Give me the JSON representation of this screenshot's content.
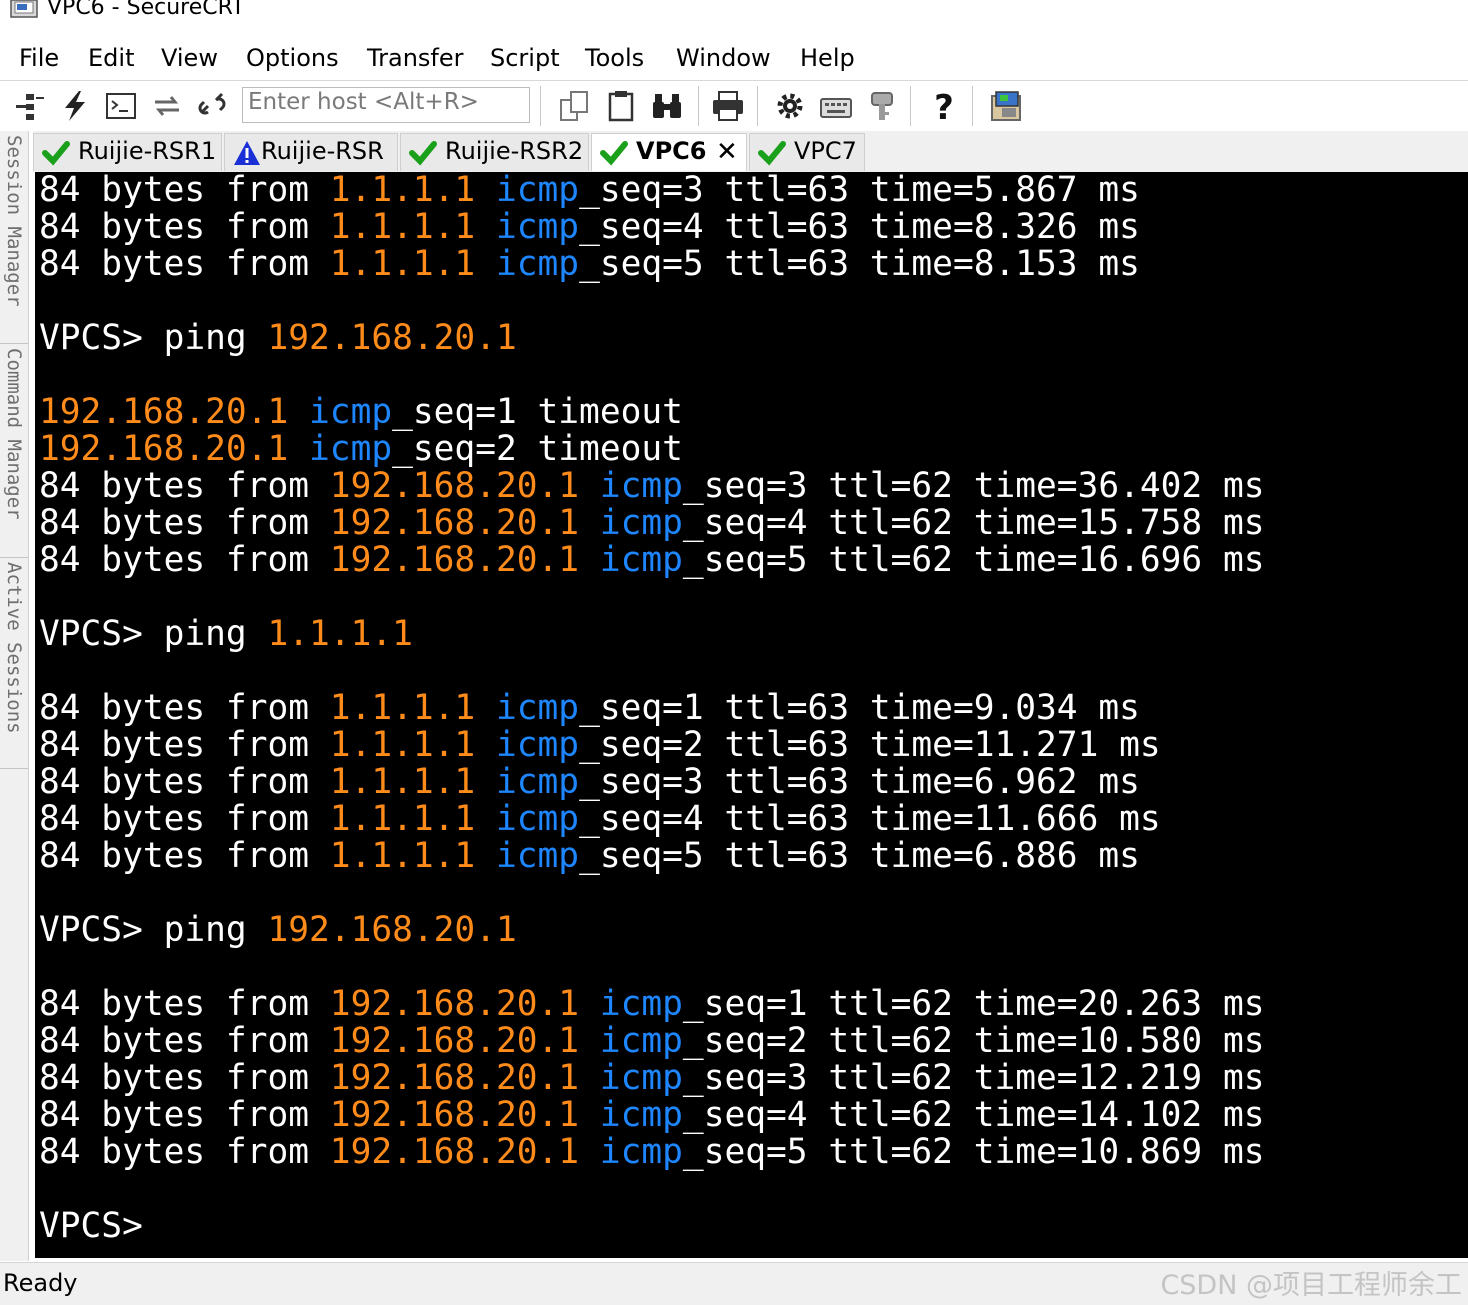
{
  "window": {
    "title": "VPC6 - SecureCRT"
  },
  "menu": [
    "File",
    "Edit",
    "View",
    "Options",
    "Transfer",
    "Script",
    "Tools",
    "Window",
    "Help"
  ],
  "toolbar": {
    "quick_connect_placeholder": "Enter host <Alt+R>",
    "icons": [
      "connect-icon",
      "quick-connect-icon",
      "connect-in-tab-icon",
      "reconnect-icon",
      "disconnect-icon",
      "copy-icon",
      "paste-icon",
      "find-icon",
      "print-icon",
      "settings-icon",
      "keymap-icon",
      "key-icon",
      "help-icon",
      "sftp-icon"
    ]
  },
  "side_panel": [
    "Session Manager",
    "Command Manager",
    "Active Sessions"
  ],
  "tabs": [
    {
      "label": "Ruijie-RSR1",
      "status": "connected",
      "active": false
    },
    {
      "label": "Ruijie-RSR",
      "status": "warning",
      "active": false
    },
    {
      "label": "Ruijie-RSR2",
      "status": "connected",
      "active": false
    },
    {
      "label": "VPC6",
      "status": "connected",
      "active": true,
      "close": "✕"
    },
    {
      "label": "VPC7",
      "status": "connected",
      "active": false
    }
  ],
  "colors": {
    "ip": "#ff8c1a",
    "icmp": "#1e86ff",
    "text": "#ffffff",
    "background": "#000000",
    "ok_check": "#1aa01a",
    "warning": "#1a2fd6"
  },
  "terminal": {
    "lines": [
      [
        [
          "84 bytes from ",
          "w"
        ],
        [
          "1.1.1.1",
          "o"
        ],
        [
          " ",
          "w"
        ],
        [
          "icmp",
          "b"
        ],
        [
          "_seq=3 ttl=63 time=5.867 ms",
          "w"
        ]
      ],
      [
        [
          "84 bytes from ",
          "w"
        ],
        [
          "1.1.1.1",
          "o"
        ],
        [
          " ",
          "w"
        ],
        [
          "icmp",
          "b"
        ],
        [
          "_seq=4 ttl=63 time=8.326 ms",
          "w"
        ]
      ],
      [
        [
          "84 bytes from ",
          "w"
        ],
        [
          "1.1.1.1",
          "o"
        ],
        [
          " ",
          "w"
        ],
        [
          "icmp",
          "b"
        ],
        [
          "_seq=5 ttl=63 time=8.153 ms",
          "w"
        ]
      ],
      [],
      [
        [
          "VPCS> ping ",
          "w"
        ],
        [
          "192.168.20.1",
          "o"
        ]
      ],
      [],
      [
        [
          "192.168.20.1",
          "o"
        ],
        [
          " ",
          "w"
        ],
        [
          "icmp",
          "b"
        ],
        [
          "_seq=1 timeout",
          "w"
        ]
      ],
      [
        [
          "192.168.20.1",
          "o"
        ],
        [
          " ",
          "w"
        ],
        [
          "icmp",
          "b"
        ],
        [
          "_seq=2 timeout",
          "w"
        ]
      ],
      [
        [
          "84 bytes from ",
          "w"
        ],
        [
          "192.168.20.1",
          "o"
        ],
        [
          " ",
          "w"
        ],
        [
          "icmp",
          "b"
        ],
        [
          "_seq=3 ttl=62 time=36.402 ms",
          "w"
        ]
      ],
      [
        [
          "84 bytes from ",
          "w"
        ],
        [
          "192.168.20.1",
          "o"
        ],
        [
          " ",
          "w"
        ],
        [
          "icmp",
          "b"
        ],
        [
          "_seq=4 ttl=62 time=15.758 ms",
          "w"
        ]
      ],
      [
        [
          "84 bytes from ",
          "w"
        ],
        [
          "192.168.20.1",
          "o"
        ],
        [
          " ",
          "w"
        ],
        [
          "icmp",
          "b"
        ],
        [
          "_seq=5 ttl=62 time=16.696 ms",
          "w"
        ]
      ],
      [],
      [
        [
          "VPCS> ping ",
          "w"
        ],
        [
          "1.1.1.1",
          "o"
        ]
      ],
      [],
      [
        [
          "84 bytes from ",
          "w"
        ],
        [
          "1.1.1.1",
          "o"
        ],
        [
          " ",
          "w"
        ],
        [
          "icmp",
          "b"
        ],
        [
          "_seq=1 ttl=63 time=9.034 ms",
          "w"
        ]
      ],
      [
        [
          "84 bytes from ",
          "w"
        ],
        [
          "1.1.1.1",
          "o"
        ],
        [
          " ",
          "w"
        ],
        [
          "icmp",
          "b"
        ],
        [
          "_seq=2 ttl=63 time=11.271 ms",
          "w"
        ]
      ],
      [
        [
          "84 bytes from ",
          "w"
        ],
        [
          "1.1.1.1",
          "o"
        ],
        [
          " ",
          "w"
        ],
        [
          "icmp",
          "b"
        ],
        [
          "_seq=3 ttl=63 time=6.962 ms",
          "w"
        ]
      ],
      [
        [
          "84 bytes from ",
          "w"
        ],
        [
          "1.1.1.1",
          "o"
        ],
        [
          " ",
          "w"
        ],
        [
          "icmp",
          "b"
        ],
        [
          "_seq=4 ttl=63 time=11.666 ms",
          "w"
        ]
      ],
      [
        [
          "84 bytes from ",
          "w"
        ],
        [
          "1.1.1.1",
          "o"
        ],
        [
          " ",
          "w"
        ],
        [
          "icmp",
          "b"
        ],
        [
          "_seq=5 ttl=63 time=6.886 ms",
          "w"
        ]
      ],
      [],
      [
        [
          "VPCS> ping ",
          "w"
        ],
        [
          "192.168.20.1",
          "o"
        ]
      ],
      [],
      [
        [
          "84 bytes from ",
          "w"
        ],
        [
          "192.168.20.1",
          "o"
        ],
        [
          " ",
          "w"
        ],
        [
          "icmp",
          "b"
        ],
        [
          "_seq=1 ttl=62 time=20.263 ms",
          "w"
        ]
      ],
      [
        [
          "84 bytes from ",
          "w"
        ],
        [
          "192.168.20.1",
          "o"
        ],
        [
          " ",
          "w"
        ],
        [
          "icmp",
          "b"
        ],
        [
          "_seq=2 ttl=62 time=10.580 ms",
          "w"
        ]
      ],
      [
        [
          "84 bytes from ",
          "w"
        ],
        [
          "192.168.20.1",
          "o"
        ],
        [
          " ",
          "w"
        ],
        [
          "icmp",
          "b"
        ],
        [
          "_seq=3 ttl=62 time=12.219 ms",
          "w"
        ]
      ],
      [
        [
          "84 bytes from ",
          "w"
        ],
        [
          "192.168.20.1",
          "o"
        ],
        [
          " ",
          "w"
        ],
        [
          "icmp",
          "b"
        ],
        [
          "_seq=4 ttl=62 time=14.102 ms",
          "w"
        ]
      ],
      [
        [
          "84 bytes from ",
          "w"
        ],
        [
          "192.168.20.1",
          "o"
        ],
        [
          " ",
          "w"
        ],
        [
          "icmp",
          "b"
        ],
        [
          "_seq=5 ttl=62 time=10.869 ms",
          "w"
        ]
      ],
      [],
      [
        [
          "VPCS>",
          "w"
        ]
      ]
    ]
  },
  "status": {
    "text": "Ready",
    "watermark": "CSDN @项目工程师余工"
  }
}
